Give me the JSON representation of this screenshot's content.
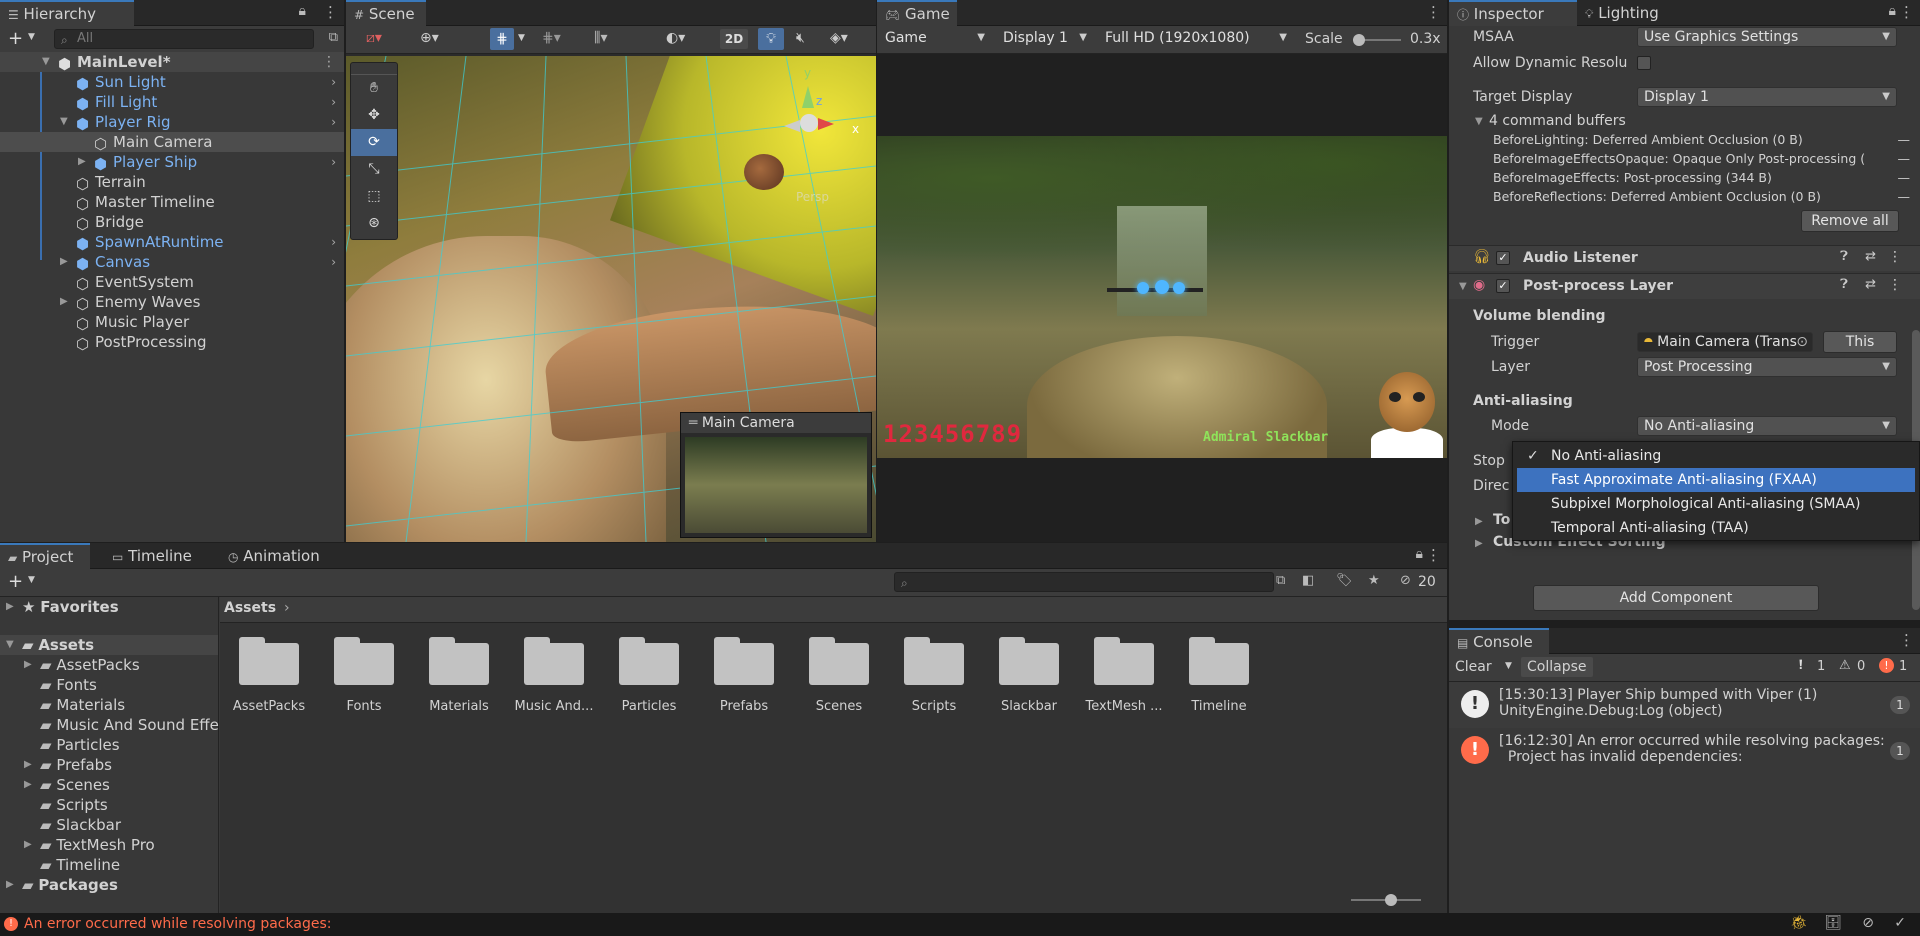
{
  "hierarchy": {
    "tab": "Hierarchy",
    "search_placeholder": "All",
    "items": [
      {
        "label": "MainLevel*"
      },
      {
        "label": "Sun Light"
      },
      {
        "label": "Fill Light"
      },
      {
        "label": "Player Rig"
      },
      {
        "label": "Main Camera"
      },
      {
        "label": "Player Ship"
      },
      {
        "label": "Terrain"
      },
      {
        "label": "Master Timeline"
      },
      {
        "label": "Bridge"
      },
      {
        "label": "SpawnAtRuntime"
      },
      {
        "label": "Canvas"
      },
      {
        "label": "EventSystem"
      },
      {
        "label": "Enemy Waves"
      },
      {
        "label": "Music Player"
      },
      {
        "label": "PostProcessing"
      }
    ]
  },
  "scene": {
    "tab": "Scene",
    "btn_2d": "2D",
    "persp_label": "Persp",
    "axis_x": "x",
    "axis_y": "y",
    "axis_z": "z",
    "camera_preview_title": "Main Camera"
  },
  "game": {
    "tab": "Game",
    "mode": "Game",
    "display": "Display 1",
    "resolution": "Full HD (1920x1080)",
    "scale_label": "Scale",
    "scale_value": "0.3x",
    "score_text": "123456789",
    "player_name": "Admiral Slackbar"
  },
  "inspector": {
    "tab_inspector": "Inspector",
    "tab_lighting": "Lighting",
    "msaa_label": "MSAA",
    "msaa_value": "Use Graphics Settings",
    "dyn_res_label": "Allow Dynamic Resolu",
    "target_display_label": "Target Display",
    "target_display_value": "Display 1",
    "command_buffers_label": "4 command buffers",
    "command_buffers": [
      "BeforeLighting: Deferred Ambient Occlusion (0 B)",
      "BeforeImageEffectsOpaque: Opaque Only Post-processing (",
      "BeforeImageEffects: Post-processing (344 B)",
      "BeforeReflections: Deferred Ambient Occlusion (0 B)"
    ],
    "remove_all": "Remove all",
    "audio_listener": "Audio Listener",
    "post_process_layer": "Post-process Layer",
    "volume_blending": "Volume blending",
    "trigger_label": "Trigger",
    "trigger_value": "Main Camera (Trans",
    "this_button": "This",
    "layer_label": "Layer",
    "layer_value": "Post Processing",
    "anti_aliasing": "Anti-aliasing",
    "mode_label": "Mode",
    "mode_value": "No Anti-aliasing",
    "stop_label": "Stop",
    "direc_label": "Direc",
    "to_label": "To",
    "custom_effect_sorting": "Custom Effect Sorting",
    "add_component": "Add Component",
    "dropdown_options": [
      "No Anti-aliasing",
      "Fast Approximate Anti-aliasing (FXAA)",
      "Subpixel Morphological Anti-aliasing (SMAA)",
      "Temporal Anti-aliasing (TAA)"
    ]
  },
  "project": {
    "tab_project": "Project",
    "tab_timeline": "Timeline",
    "tab_animation": "Animation",
    "hidden_count": "20",
    "favorites": "Favorites",
    "assets_root": "Assets",
    "packages": "Packages",
    "tree": [
      "AssetPacks",
      "Fonts",
      "Materials",
      "Music And Sound Effe",
      "Particles",
      "Prefabs",
      "Scenes",
      "Scripts",
      "Slackbar",
      "TextMesh Pro",
      "Timeline"
    ],
    "breadcrumb": "Assets",
    "folders": [
      "AssetPacks",
      "Fonts",
      "Materials",
      "Music And...",
      "Particles",
      "Prefabs",
      "Scenes",
      "Scripts",
      "Slackbar",
      "TextMesh ...",
      "Timeline"
    ]
  },
  "console": {
    "tab": "Console",
    "clear": "Clear",
    "collapse": "Collapse",
    "count_log": "1",
    "count_warn": "0",
    "count_error": "1",
    "entries": [
      {
        "line1": "[15:30:13] Player Ship bumped with Viper (1)",
        "line2": "UnityEngine.Debug:Log (object)",
        "count": "1"
      },
      {
        "line1": "[16:12:30] An error occurred while resolving packages:",
        "line2": "  Project has invalid dependencies:",
        "count": "1"
      }
    ]
  },
  "status_bar": {
    "message": "An error occurred while resolving packages:"
  },
  "colors": {
    "accent": "#3d72bf",
    "prefab_blue": "#7cb2f2",
    "error_red": "#ff6b4a"
  }
}
